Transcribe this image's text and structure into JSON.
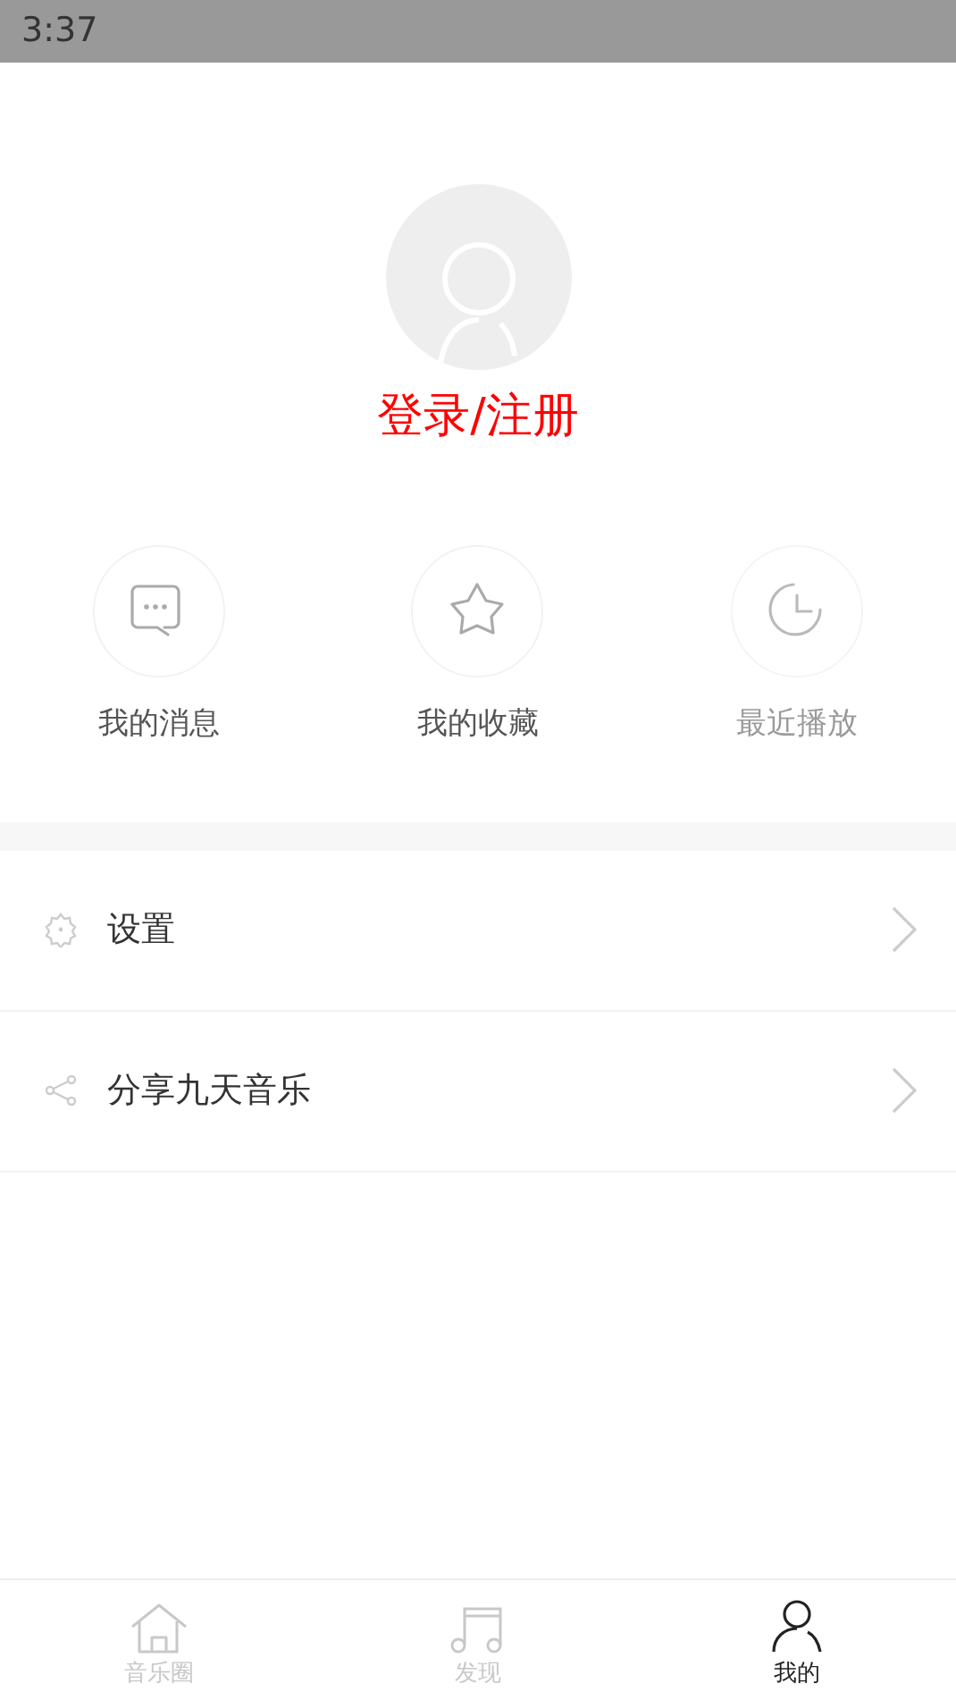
{
  "status_bar": {
    "time": "3:37"
  },
  "profile": {
    "login_label": "登录/注册"
  },
  "shortcuts": [
    {
      "label": "我的消息",
      "disabled": false
    },
    {
      "label": "我的收藏",
      "disabled": false
    },
    {
      "label": "最近播放",
      "disabled": true
    }
  ],
  "menu": [
    {
      "label": "设置"
    },
    {
      "label": "分享九天音乐"
    }
  ],
  "tab_bar": [
    {
      "label": "音乐圈",
      "selected": false
    },
    {
      "label": "发现",
      "selected": false
    },
    {
      "label": "我的",
      "selected": true
    }
  ]
}
